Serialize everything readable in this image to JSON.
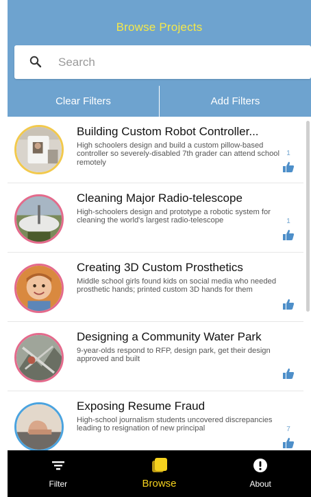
{
  "header": {
    "title": "Browse Projects"
  },
  "search": {
    "placeholder": "Search",
    "value": ""
  },
  "filters": {
    "clear_label": "Clear Filters",
    "add_label": "Add Filters"
  },
  "projects": [
    {
      "title": "Building Custom Robot Controller...",
      "description": "High schoolers design and build a custom pillow-based controller so severely-disabled 7th grader can attend school remotely",
      "likes": "1",
      "ring_color": "#f2c94c"
    },
    {
      "title": "Cleaning Major Radio-telescope",
      "description": "High-schoolers design and prototype a robotic system for cleaning the world's largest radio-telescope",
      "likes": "1",
      "ring_color": "#e46a8c"
    },
    {
      "title": "Creating 3D Custom Prosthetics",
      "description": "Middle school girls found kids on social media who needed prosthetic hands; printed custom 3D hands for them",
      "likes": "",
      "ring_color": "#e46a8c"
    },
    {
      "title": "Designing a Community Water Park",
      "description": "9-year-olds respond to RFP, design park, get their design approved and built",
      "likes": "",
      "ring_color": "#e46a8c"
    },
    {
      "title": "Exposing Resume Fraud",
      "description": "High-school journalism students uncovered discrepancies leading to resignation of new principal",
      "likes": "7",
      "ring_color": "#4aa3df"
    }
  ],
  "tabs": [
    {
      "label": "Filter",
      "icon": "filter-icon",
      "active": false
    },
    {
      "label": "Browse",
      "icon": "browse-icon",
      "active": true
    },
    {
      "label": "About",
      "icon": "info-icon",
      "active": false
    }
  ],
  "colors": {
    "header": "#6ea3cf",
    "title": "#f5e84a",
    "accent": "#f5d21e",
    "like": "#6ea3cf"
  }
}
